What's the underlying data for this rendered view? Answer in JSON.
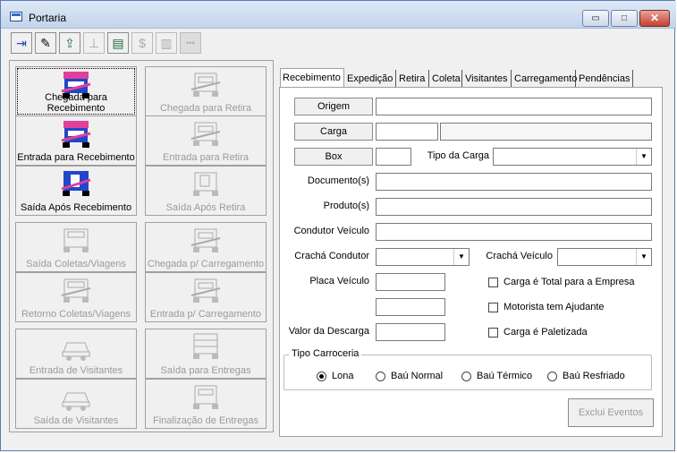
{
  "window": {
    "title": "Portaria",
    "buttons": {
      "minimize": "▭",
      "maximize": "□",
      "close": "✕"
    }
  },
  "toolbar": {
    "items": [
      {
        "name": "exit-icon",
        "glyph": "⇥"
      },
      {
        "name": "pencil-icon",
        "glyph": "✎"
      },
      {
        "name": "folder-upload-icon",
        "glyph": "⇪"
      },
      {
        "name": "stamp-icon",
        "glyph": "⊥"
      },
      {
        "name": "report-icon",
        "glyph": "▤"
      },
      {
        "name": "dollar-icon",
        "glyph": "$"
      },
      {
        "name": "book-icon",
        "glyph": "▥"
      },
      {
        "name": "more-icon",
        "glyph": "•••"
      }
    ]
  },
  "tiles": {
    "chegada_recebimento": "Chegada para Recebimento",
    "chegada_retira": "Chegada para Retira",
    "entrada_recebimento": "Entrada para Recebimento",
    "entrada_retira": "Entrada para Retira",
    "saida_apos_recebimento": "Saída Após Recebimento",
    "saida_apos_retira": "Saída Após Retira",
    "saida_coletas": "Saída Coletas/Viagens",
    "chegada_carregamento": "Chegada p/ Carregamento",
    "retorno_coletas": "Retorno Coletas/Viagens",
    "entrada_carregamento": "Entrada p/ Carregamento",
    "entrada_visitantes": "Entrada de Visitantes",
    "saida_entregas": "Saída para Entregas",
    "saida_visitantes": "Saída de Visitantes",
    "finalizacao_entregas": "Finalização de Entregas"
  },
  "tabs": [
    "Recebimento",
    "Expedição",
    "Retira",
    "Coleta",
    "Visitantes",
    "Carregamento",
    "Pendências"
  ],
  "form": {
    "origem": "Origem",
    "carga": "Carga",
    "box": "Box",
    "tipo_carga": "Tipo da Carga",
    "documentos": "Documento(s)",
    "produtos": "Produto(s)",
    "condutor": "Condutor Veículo",
    "cracha_condutor": "Crachá Condutor",
    "cracha_veiculo": "Crachá Veículo",
    "placa": "Placa Veículo",
    "valor_descarga": "Valor da Descarga",
    "chk_carga_total": "Carga é Total para a Empresa",
    "chk_motorista": "Motorista tem Ajudante",
    "chk_paletizada": "Carga é Paletizada",
    "tipo_carroceria": "Tipo Carroceria",
    "radios": [
      "Lona",
      "Baú Normal",
      "Baú Térmico",
      "Baú Resfriado"
    ],
    "exclui_eventos": "Exclui Eventos"
  },
  "colors": {
    "accent_pink": "#e0409a",
    "truck_blue": "#2146c9",
    "disabled_text": "#9a9a9a"
  }
}
